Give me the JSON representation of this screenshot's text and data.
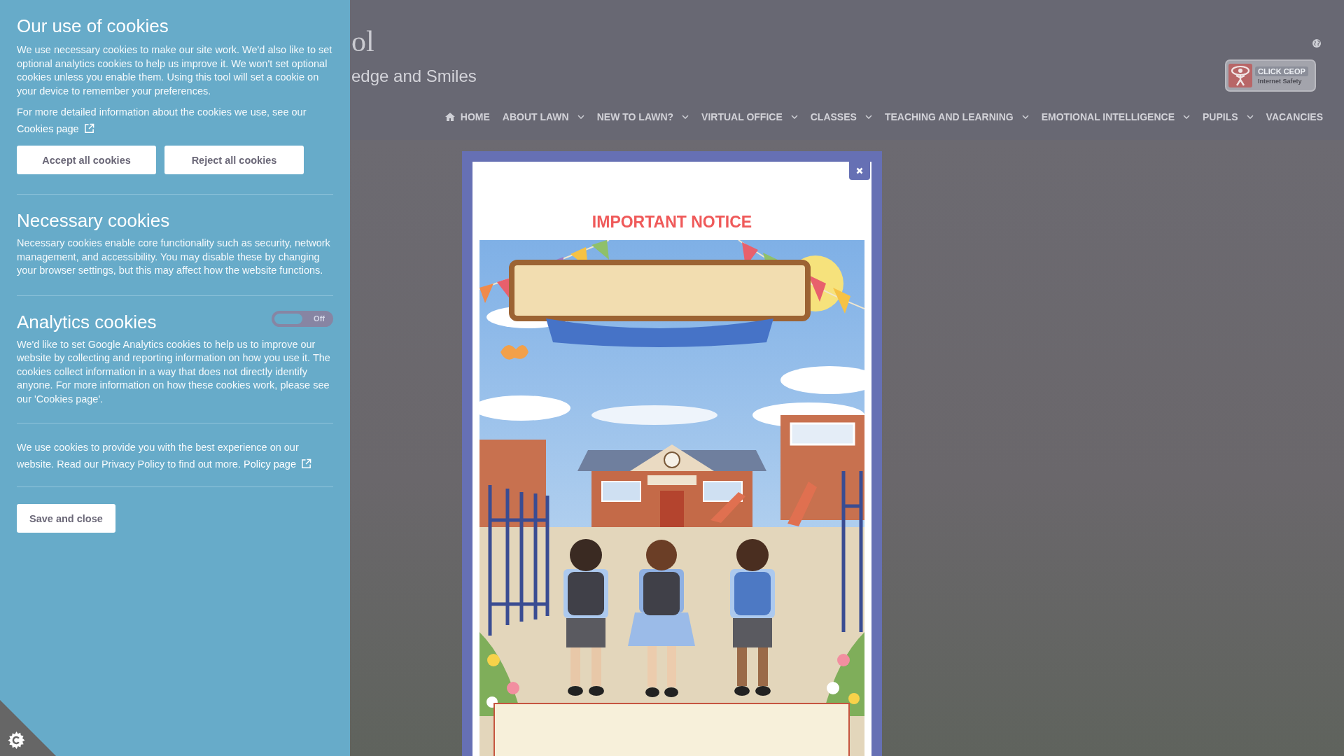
{
  "cookie_panel": {
    "title": "Our use of cookies",
    "intro": "We use necessary cookies to make our site work. We'd also like to set optional analytics cookies to help us improve it. We won't set optional cookies unless you enable them. Using this tool will set a cookie on your device to remember your preferences.",
    "more_info": {
      "text": "For more detailed information about the cookies we use, see our",
      "link": "Cookies page"
    },
    "buttons": [
      "Accept all cookies",
      "Reject all cookies"
    ],
    "sections": [
      {
        "kind": "plain",
        "title": "Necessary cookies",
        "text": "Necessary cookies enable core functionality such as security, network management, and accessibility. You may disable these by changing your browser settings, but this may affect how the website functions."
      },
      {
        "kind": "toggle",
        "title": "Analytics cookies",
        "toggle": {
          "on": false,
          "label": "Off"
        },
        "text": "We'd like to set Google Analytics cookies to help us to improve our website by collecting and reporting information on how you use it. The cookies collect information in a way that does not directly identify anyone. For more information on how these cookies work, please see our 'Cookies page'."
      }
    ],
    "privacy": {
      "text": "We use cookies to provide you with the best experience on our website. Read our Privacy Policy to find out more.",
      "link": "Policy page"
    },
    "save_button": "Save and close"
  },
  "header": {
    "title": "ol",
    "tagline": "edge and Smiles",
    "badge": {
      "title": "CLICK CEOP",
      "subtitle": "Internet Safety"
    }
  },
  "nav": [
    {
      "label": "HOME",
      "kind": "home"
    },
    {
      "label": "ABOUT LAWN",
      "kind": "dropdown"
    },
    {
      "label": "NEW TO LAWN?",
      "kind": "dropdown"
    },
    {
      "label": "VIRTUAL OFFICE",
      "kind": "dropdown"
    },
    {
      "label": "CLASSES",
      "kind": "dropdown"
    },
    {
      "label": "TEACHING AND LEARNING",
      "kind": "dropdown"
    },
    {
      "label": "EMOTIONAL INTELLIGENCE",
      "kind": "dropdown"
    },
    {
      "label": "PUPILS",
      "kind": "dropdown"
    },
    {
      "label": "VACANCIES",
      "kind": "link"
    }
  ],
  "modal": {
    "title": "IMPORTANT NOTICE"
  }
}
